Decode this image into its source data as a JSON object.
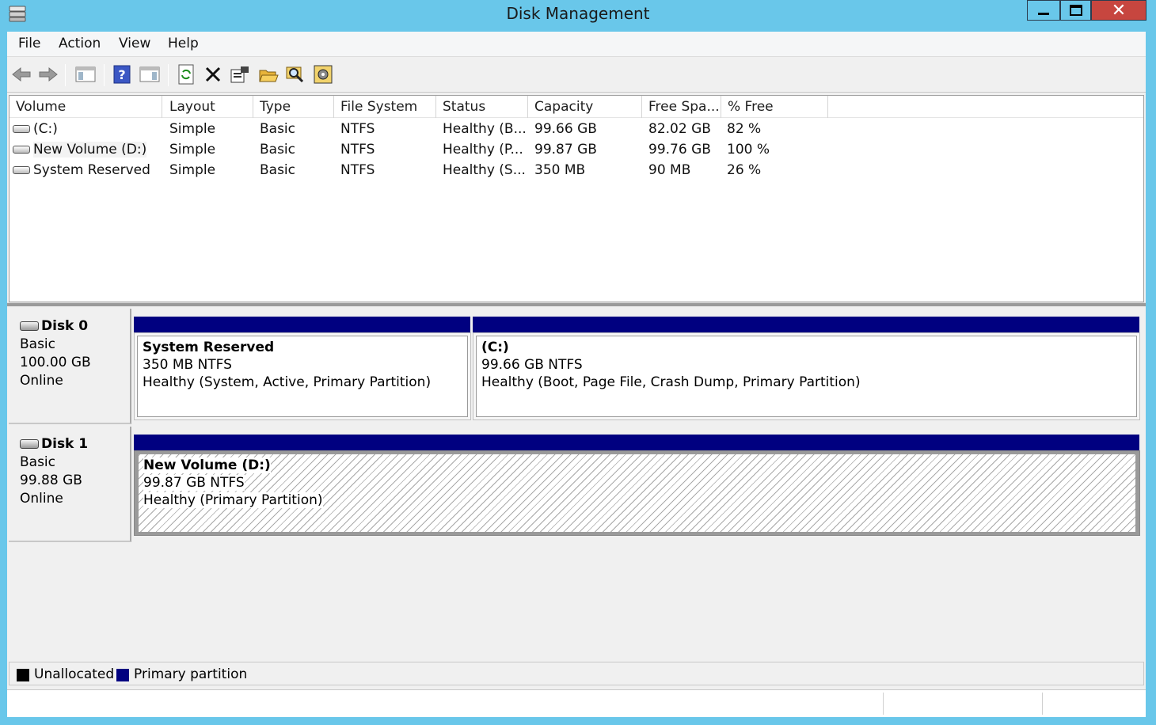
{
  "window": {
    "title": "Disk Management",
    "close_glyph": "✕"
  },
  "menu": {
    "items": [
      "File",
      "Action",
      "View",
      "Help"
    ]
  },
  "toolbar": {
    "icons": [
      "back-arrow-icon",
      "forward-arrow-icon",
      "show-hide-console-tree-icon",
      "help-icon",
      "show-hide-action-pane-icon",
      "refresh-icon",
      "delete-icon",
      "properties-icon",
      "open-folder-icon",
      "search-icon",
      "settings-icon"
    ]
  },
  "volume_list": {
    "columns": [
      "Volume",
      "Layout",
      "Type",
      "File System",
      "Status",
      "Capacity",
      "Free Spa...",
      "% Free"
    ],
    "rows": [
      {
        "volume": "(C:)",
        "layout": "Simple",
        "type": "Basic",
        "fs": "NTFS",
        "status": "Healthy (B...",
        "capacity": "99.66 GB",
        "free": "82.02 GB",
        "pct": "82 %"
      },
      {
        "volume": "New Volume (D:)",
        "layout": "Simple",
        "type": "Basic",
        "fs": "NTFS",
        "status": "Healthy (P...",
        "capacity": "99.87 GB",
        "free": "99.76 GB",
        "pct": "100 %"
      },
      {
        "volume": "System Reserved",
        "layout": "Simple",
        "type": "Basic",
        "fs": "NTFS",
        "status": "Healthy (S...",
        "capacity": "350 MB",
        "free": "90 MB",
        "pct": "26 %"
      }
    ]
  },
  "disks": [
    {
      "name": "Disk 0",
      "type": "Basic",
      "size": "100.00 GB",
      "state": "Online",
      "partitions": [
        {
          "name": "System Reserved",
          "size": "350 MB NTFS",
          "status": "Healthy (System, Active, Primary Partition)"
        },
        {
          "name": "(C:)",
          "size": "99.66 GB NTFS",
          "status": "Healthy (Boot, Page File, Crash Dump, Primary Partition)"
        }
      ]
    },
    {
      "name": "Disk 1",
      "type": "Basic",
      "size": "99.88 GB",
      "state": "Online",
      "partitions": [
        {
          "name": "New Volume  (D:)",
          "size": "99.87 GB NTFS",
          "status": "Healthy (Primary Partition)"
        }
      ]
    }
  ],
  "legend": [
    {
      "label": "Unallocated",
      "color": "#000000"
    },
    {
      "label": "Primary partition",
      "color": "#000080"
    }
  ]
}
